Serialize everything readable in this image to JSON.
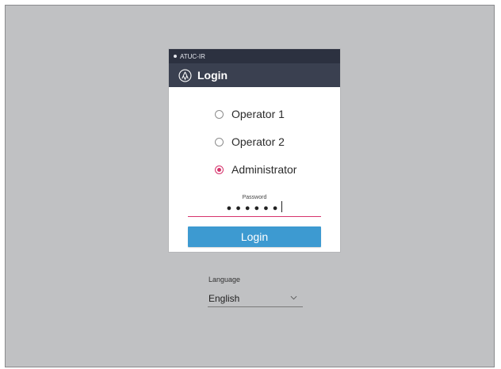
{
  "device": {
    "name": "ATUC-IR",
    "status_icon": "status-dot-icon"
  },
  "login_card": {
    "title": "Login",
    "logo_icon": "audio-technica-logo-icon",
    "roles": [
      {
        "label": "Operator 1",
        "selected": false
      },
      {
        "label": "Operator 2",
        "selected": false
      },
      {
        "label": "Administrator",
        "selected": true
      }
    ],
    "password": {
      "label": "Password",
      "masked_value": "●●●●●●"
    },
    "login_button": "Login"
  },
  "language": {
    "label": "Language",
    "selected": "English",
    "icon": "chevron-down-icon"
  },
  "colors": {
    "background": "#c0c1c3",
    "header": "#3a4050",
    "accent": "#d6336c",
    "button": "#3d9ad1"
  }
}
